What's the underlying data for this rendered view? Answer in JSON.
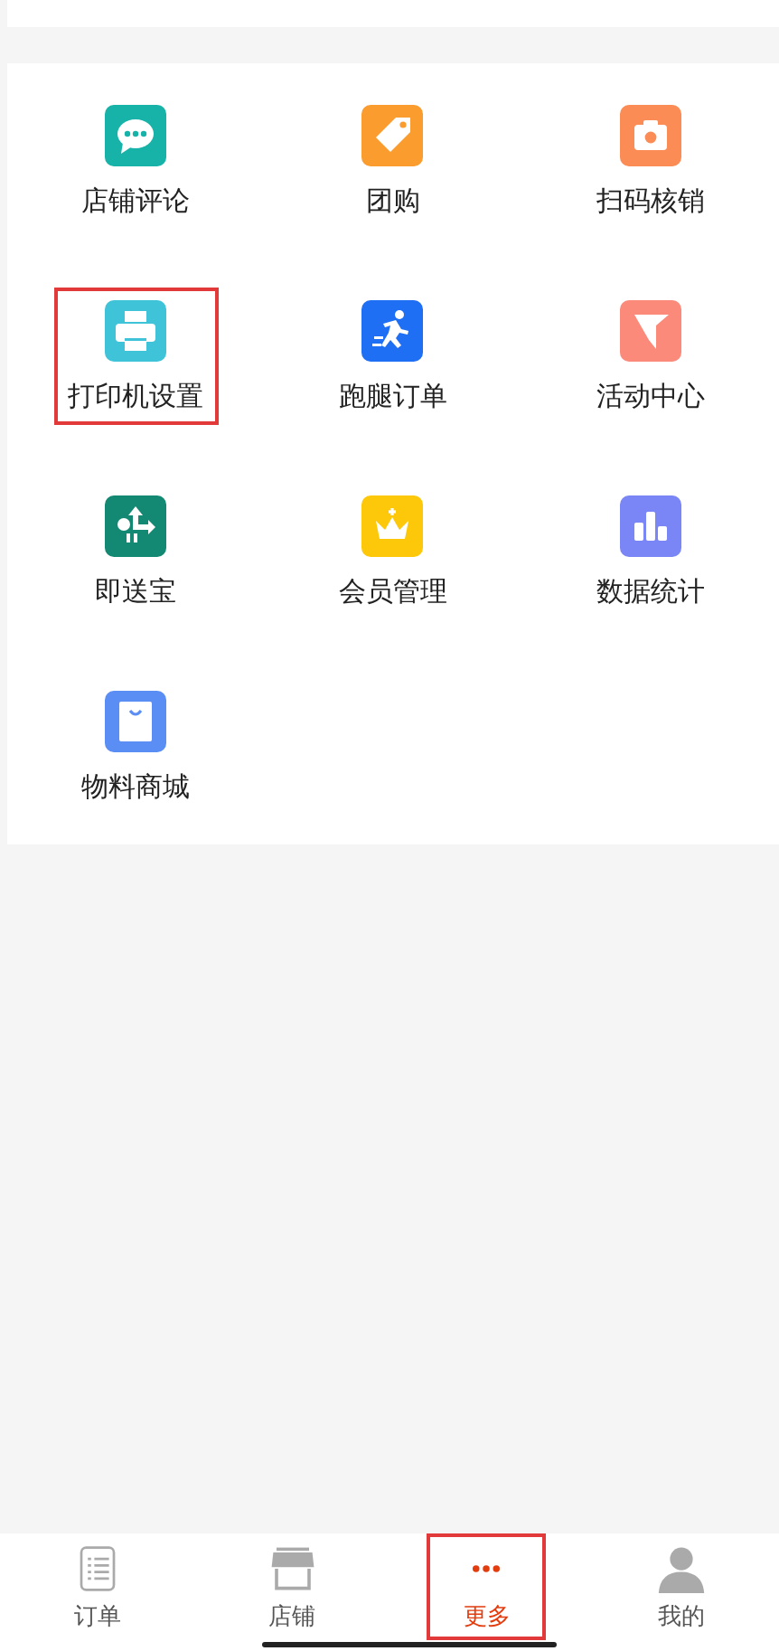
{
  "features": [
    {
      "label": "店铺评论",
      "kind": "chat",
      "color": "#17b3a9",
      "highlighted": false
    },
    {
      "label": "团购",
      "kind": "tag",
      "color": "#fb9c2e",
      "highlighted": false
    },
    {
      "label": "扫码核销",
      "kind": "camera",
      "color": "#fb8c55",
      "highlighted": false
    },
    {
      "label": "打印机设置",
      "kind": "printer",
      "color": "#3fc3d8",
      "highlighted": true
    },
    {
      "label": "跑腿订单",
      "kind": "runner",
      "color": "#1f6ff5",
      "highlighted": false
    },
    {
      "label": "活动中心",
      "kind": "flag",
      "color": "#fb8a7a",
      "highlighted": false
    },
    {
      "label": "即送宝",
      "kind": "route",
      "color": "#138872",
      "highlighted": false
    },
    {
      "label": "会员管理",
      "kind": "crown",
      "color": "#fdc80a",
      "highlighted": false
    },
    {
      "label": "数据统计",
      "kind": "bars",
      "color": "#7b86f6",
      "highlighted": false
    },
    {
      "label": "物料商城",
      "kind": "bag",
      "color": "#5b8ef5",
      "highlighted": false
    }
  ],
  "tab_bar": [
    {
      "label": "订单",
      "kind": "list",
      "selected": false,
      "highlighted": false
    },
    {
      "label": "店铺",
      "kind": "shop",
      "selected": false,
      "highlighted": false
    },
    {
      "label": "更多",
      "kind": "dots",
      "selected": true,
      "highlighted": true
    },
    {
      "label": "我的",
      "kind": "person",
      "selected": false,
      "highlighted": false
    }
  ]
}
